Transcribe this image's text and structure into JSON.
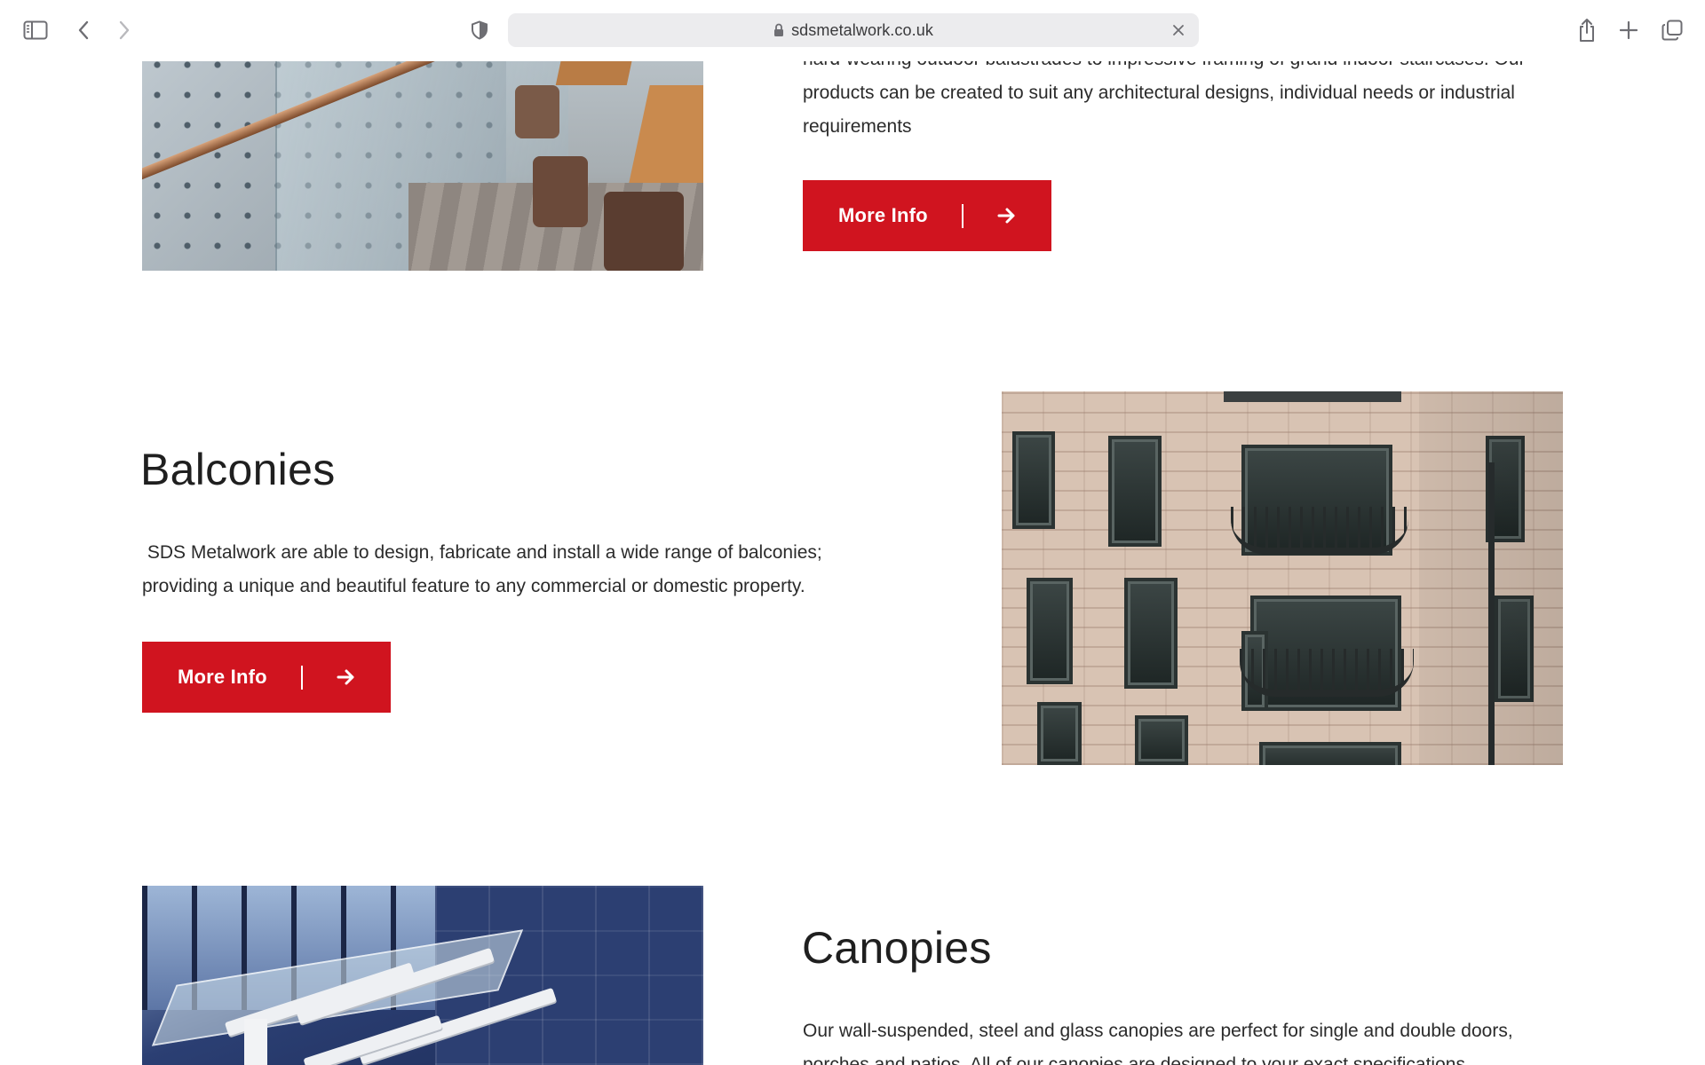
{
  "browser": {
    "address": "sdsmetalwork.co.uk",
    "icons": {
      "sidebar": "sidebar-icon",
      "back": "chevron-left-icon",
      "forward": "chevron-right-icon",
      "privacy": "shield-icon",
      "lock": "lock-icon",
      "close": "close-icon",
      "share": "share-icon",
      "new_tab": "plus-icon",
      "tab_overview": "tabs-icon"
    }
  },
  "colors": {
    "accent": "#d0141f",
    "text": "#2b2b2b",
    "heading": "#1f1f1f"
  },
  "sections": {
    "balustrades": {
      "text_line_1": "hard-wearing outdoor balustrades to impressive framing of grand indoor staircases. Our",
      "text_line_2": "products can be created to suit any architectural designs, individual needs or industrial",
      "text_line_3": "requirements",
      "button_label": "More Info",
      "button_icon": "arrow-right-icon"
    },
    "balconies": {
      "title": "Balconies",
      "text_line_1": " SDS Metalwork are able to design, fabricate and install a wide range of balconies;",
      "text_line_2": "providing a unique and beautiful feature to any commercial or domestic property.",
      "button_label": "More Info",
      "button_icon": "arrow-right-icon"
    },
    "canopies": {
      "title": "Canopies",
      "text_line_1": "Our wall-suspended, steel and glass canopies are perfect for single and double doors,",
      "text_line_2": "porches and patios. All of our canopies are designed to your exact specifications."
    }
  }
}
